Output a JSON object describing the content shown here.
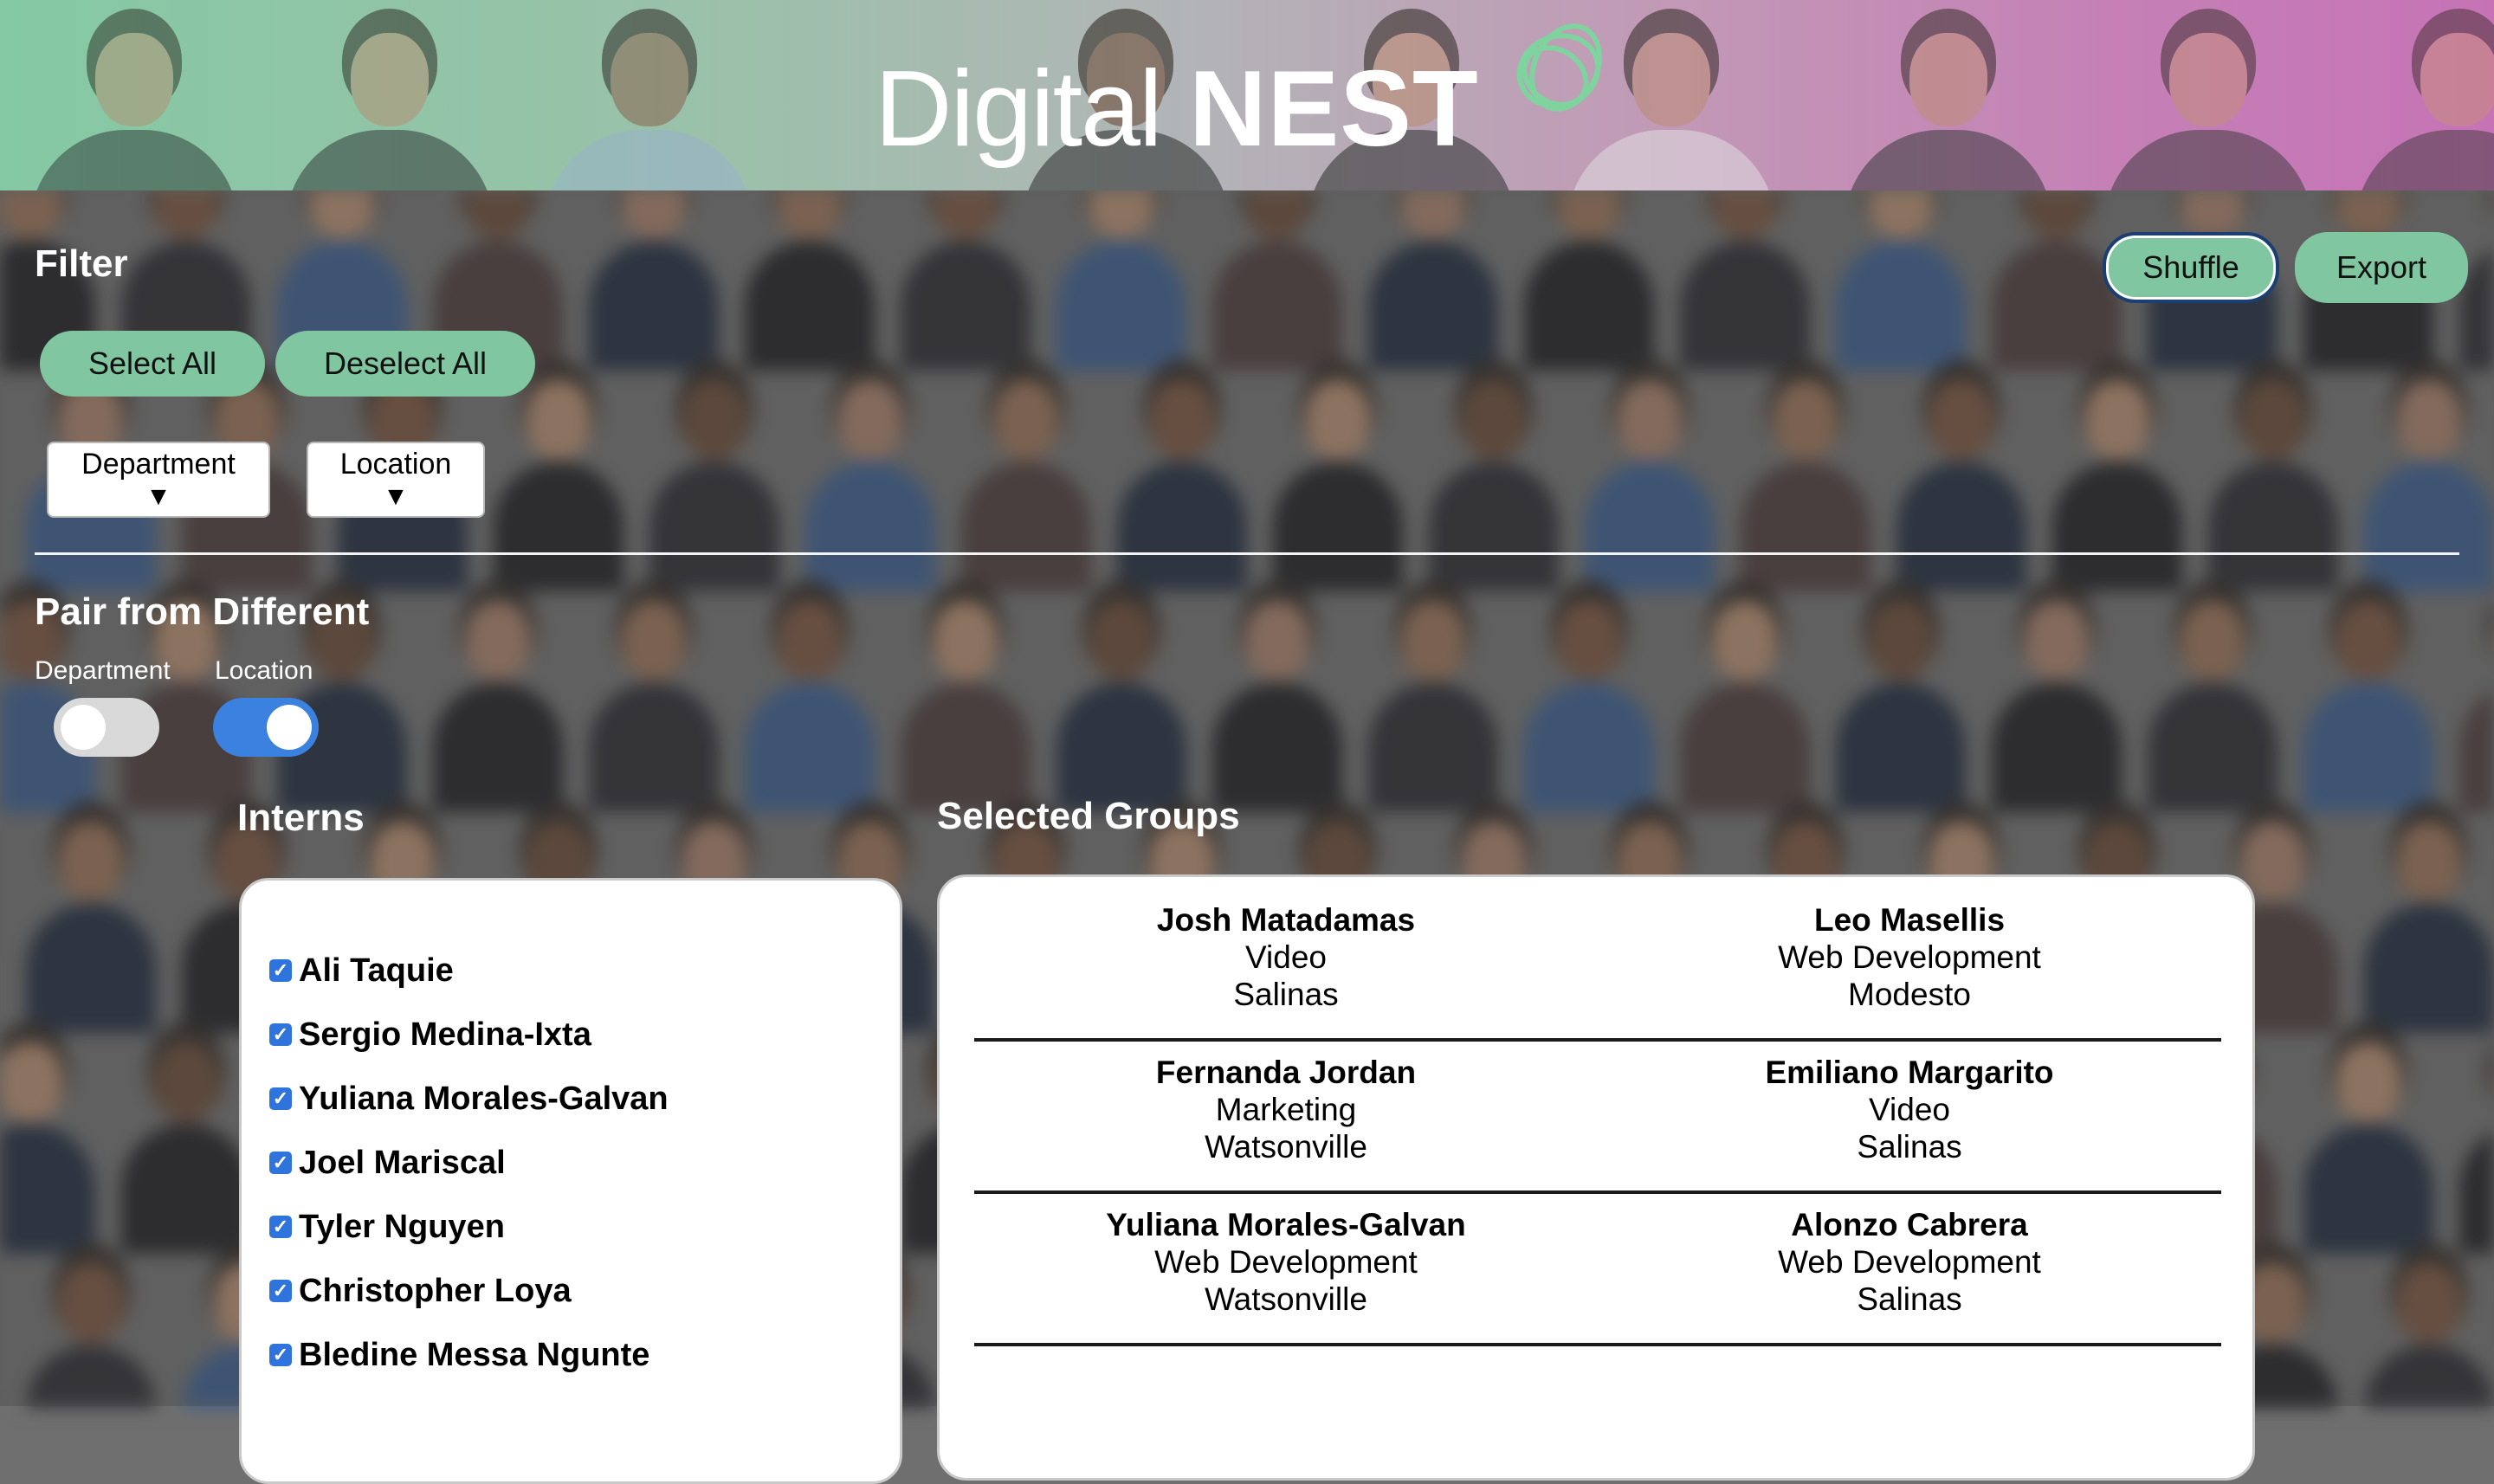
{
  "brand": {
    "name_light": "Digital",
    "name_bold": "NEST",
    "accent": "#80c6a0",
    "toggle_on": "#3b82e0"
  },
  "filter": {
    "title": "Filter",
    "select_all_label": "Select All",
    "deselect_all_label": "Deselect All",
    "department_dropdown": "Department",
    "location_dropdown": "Location",
    "dropdown_arrow": "▼"
  },
  "actions": {
    "shuffle_label": "Shuffle",
    "export_label": "Export"
  },
  "pair": {
    "title": "Pair from Different",
    "department_label": "Department",
    "department_on": false,
    "location_label": "Location",
    "location_on": true
  },
  "interns": {
    "title": "Interns",
    "items": [
      {
        "name": "Ali Taquie",
        "checked": true
      },
      {
        "name": "Sergio Medina-Ixta",
        "checked": true
      },
      {
        "name": "Yuliana Morales-Galvan",
        "checked": true
      },
      {
        "name": "Joel Mariscal",
        "checked": true
      },
      {
        "name": "Tyler Nguyen",
        "checked": true
      },
      {
        "name": "Christopher Loya",
        "checked": true
      },
      {
        "name": "Bledine Messa Ngunte",
        "checked": true
      }
    ]
  },
  "groups": {
    "title": "Selected Groups",
    "items": [
      {
        "left": {
          "name": "Josh Matadamas",
          "department": "Video",
          "location": "Salinas"
        },
        "right": {
          "name": "Leo Masellis",
          "department": "Web Development",
          "location": "Modesto"
        }
      },
      {
        "left": {
          "name": "Fernanda Jordan",
          "department": "Marketing",
          "location": "Watsonville"
        },
        "right": {
          "name": "Emiliano Margarito",
          "department": "Video",
          "location": "Salinas"
        }
      },
      {
        "left": {
          "name": "Yuliana Morales-Galvan",
          "department": "Web Development",
          "location": "Watsonville"
        },
        "right": {
          "name": "Alonzo Cabrera",
          "department": "Web Development",
          "location": "Salinas"
        }
      }
    ]
  }
}
